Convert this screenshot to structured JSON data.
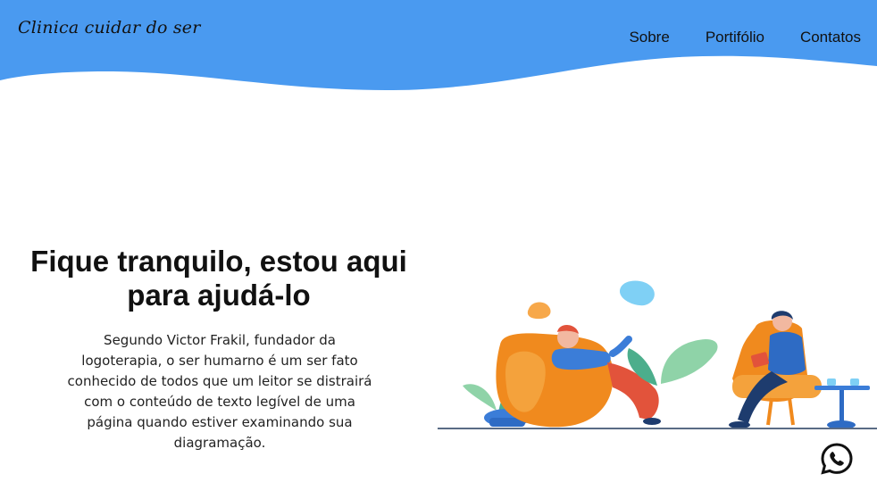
{
  "header": {
    "logo": "Clinica cuidar do ser",
    "nav": [
      {
        "label": "Sobre"
      },
      {
        "label": "Portifólio"
      },
      {
        "label": "Contatos"
      }
    ]
  },
  "hero": {
    "title_line1": "Fique tranquilo, estou aqui",
    "title_line2": "para ajudá-lo",
    "text": "Segundo Victor Frakil, fundador da logoterapia, o ser humarno é um ser fato conhecido de todos que um leitor se distrairá com o conteúdo de texto legível de uma página quando estiver examinando sua diagramação."
  },
  "illustration": {
    "name": "therapy-session-illustration"
  },
  "colors": {
    "header_blue": "#4a9af0",
    "armchair_orange": "#f08a1e",
    "accent_blue": "#3b7dd8"
  },
  "icons": {
    "whatsapp": "whatsapp-icon"
  }
}
